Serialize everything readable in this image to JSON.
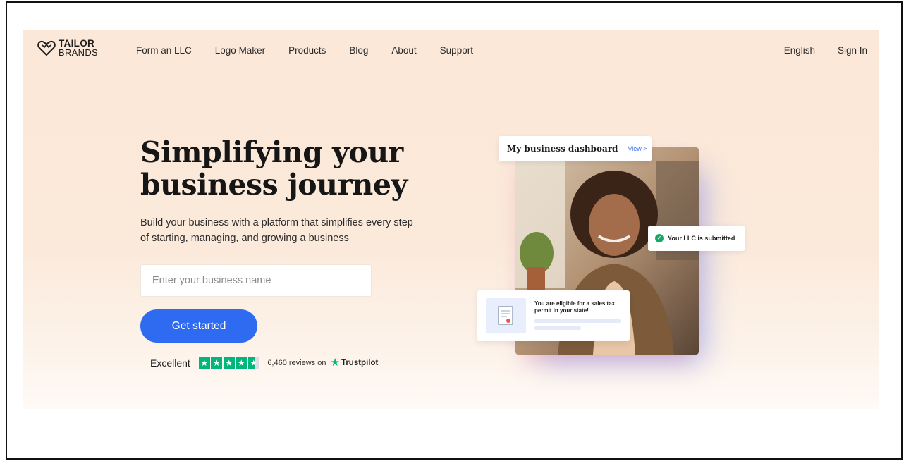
{
  "brand": {
    "logo_line1": "TAILOR",
    "logo_line2": "BRANDS",
    "logo_icon": "crown-heart-logo-icon"
  },
  "nav": {
    "items": [
      {
        "label": "Form an LLC"
      },
      {
        "label": "Logo Maker"
      },
      {
        "label": "Products"
      },
      {
        "label": "Blog"
      },
      {
        "label": "About"
      },
      {
        "label": "Support"
      }
    ],
    "language_label": "English",
    "signin_label": "Sign In"
  },
  "hero": {
    "headline_line1": "Simplifying your",
    "headline_line2": "business journey",
    "subtext": "Build your business with a platform that simplifies every step of starting, managing, and growing a business",
    "input_placeholder": "Enter your business name",
    "input_value": "",
    "cta_label": "Get started"
  },
  "trust": {
    "rating_word": "Excellent",
    "stars": 4.5,
    "reviews_text": "6,460 reviews on",
    "provider": "Trustpilot"
  },
  "visual": {
    "dashboard_title": "My business dashboard",
    "dashboard_link": "View >",
    "llc_status": "Your LLC is submitted",
    "tax_message": "You are eligible for a sales tax permit in your state!"
  },
  "colors": {
    "accent": "#2f6bf0",
    "background": "#fbe8d8",
    "trust_green": "#00b67a",
    "success": "#18a866"
  }
}
